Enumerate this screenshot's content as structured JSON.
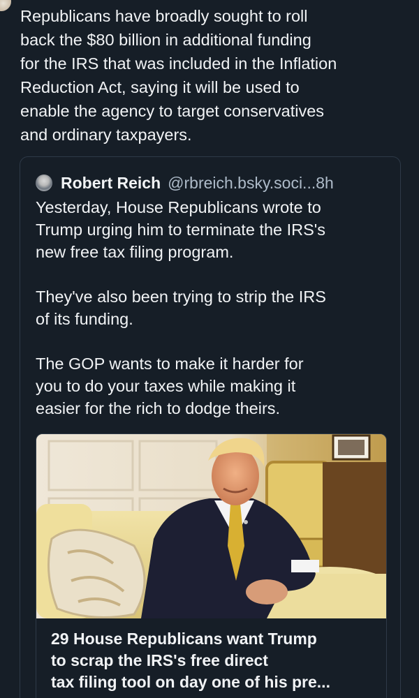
{
  "post": {
    "text": "Republicans have broadly sought to roll\nback the $80 billion in additional funding\nfor the IRS that was included in the Inflation\nReduction Act, saying it will be used to\nenable the agency to target conservatives\nand ordinary taxpayers."
  },
  "quote": {
    "author": "Robert Reich",
    "handle": "@rbreich.bsky.soci...",
    "separator": "·",
    "time": "8h",
    "paragraphs": [
      "Yesterday, House Republicans wrote to\nTrump urging him to terminate the IRS's\nnew free tax filing program.",
      "They've also been trying to strip the IRS\nof its funding.",
      "The GOP wants to make it harder for\nyou to do your taxes while making it\neasier for the rich to dodge theirs."
    ],
    "link_card": {
      "title": "29 House Republicans want Trump\nto scrap the IRS's free direct\ntax filing tool on day one of his pre..."
    }
  }
}
